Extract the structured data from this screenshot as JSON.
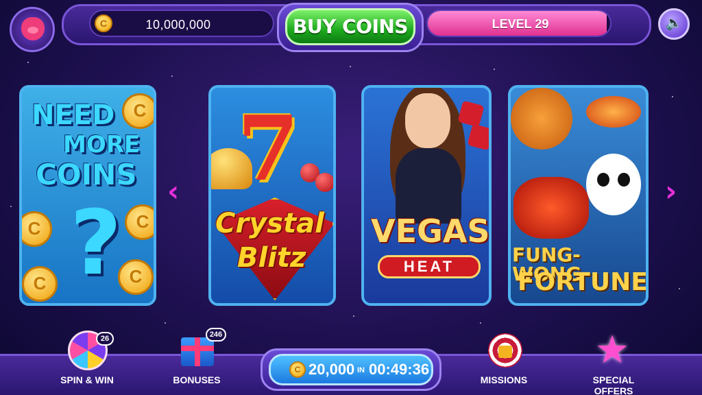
{
  "header": {
    "coins": "10,000,000",
    "coin_symbol": "C",
    "buy_label": "BUY COINS",
    "level_label": "LEVEL 29",
    "level_progress": 0.98,
    "sound_icon": "speaker-icon"
  },
  "cards": {
    "coins_promo": {
      "line1": "NEED",
      "line2": "MORE",
      "line3": "COINS",
      "mark": "?"
    },
    "crystal_blitz": {
      "line1": "Crystal",
      "line2": "Blitz",
      "big_symbol": "7"
    },
    "vegas_heat": {
      "line1": "VEGAS",
      "line2": "HEAT"
    },
    "fung_wong": {
      "line1": "FUNG-WONG",
      "line2": "FORTUNE"
    }
  },
  "nav": {
    "prev_arrow": "‹",
    "next_arrow": "›"
  },
  "bottom": {
    "spin": {
      "label": "SPIN & WIN",
      "badge": "26"
    },
    "bonuses": {
      "label": "BONUSES",
      "badge": "246"
    },
    "timer": {
      "amount": "20,000",
      "in_label": "IN",
      "time": "00:49:36"
    },
    "missions": {
      "label": "MISSIONS"
    },
    "offers": {
      "label": "SPECIAL OFFERS"
    }
  },
  "colors": {
    "accent_green": "#1ea91e",
    "accent_pink": "#e0308f",
    "accent_blue": "#1b7ae0"
  }
}
